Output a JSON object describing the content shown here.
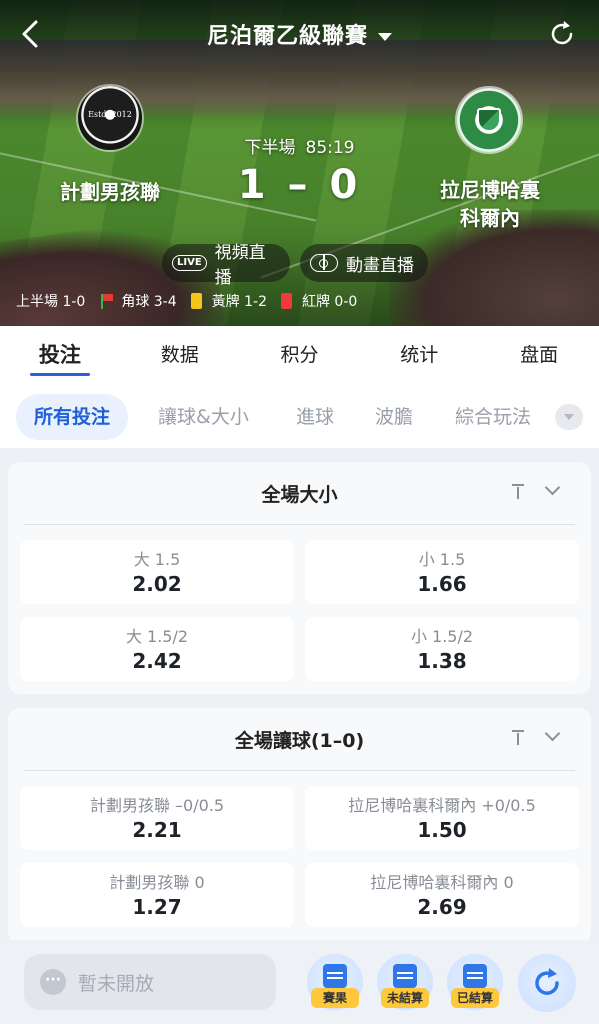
{
  "header": {
    "league_title": "尼泊爾乙級聯賽"
  },
  "match": {
    "home_team": "計劃男孩聯",
    "away_team_line1": "拉尼博哈裏",
    "away_team_line2": "科爾內",
    "home_logo_text": "Estd. 2012",
    "period": "下半場",
    "clock": "85:19",
    "score_home": "1",
    "score_sep": "–",
    "score_away": "0",
    "video_live_label": "視頻直播",
    "video_live_badge": "LIVE",
    "animation_live_label": "動畫直播",
    "stats": {
      "first_half": "上半場 1-0",
      "corners": "角球 3-4",
      "yellow_cards": "黃牌 1-2",
      "red_cards": "紅牌 0-0"
    }
  },
  "main_tabs": [
    "投注",
    "数据",
    "积分",
    "统计",
    "盘面"
  ],
  "sub_tabs": [
    "所有投注",
    "讓球&大小",
    "進球",
    "波膽",
    "綜合玩法"
  ],
  "markets": [
    {
      "title": "全場大小",
      "odds": [
        {
          "label": "大 1.5",
          "value": "2.02"
        },
        {
          "label": "小 1.5",
          "value": "1.66"
        },
        {
          "label": "大 1.5/2",
          "value": "2.42"
        },
        {
          "label": "小 1.5/2",
          "value": "1.38"
        }
      ]
    },
    {
      "title": "全場讓球(1–0)",
      "odds": [
        {
          "label": "計劃男孩聯 –0/0.5",
          "value": "2.21"
        },
        {
          "label": "拉尼博哈裏科爾內 +0/0.5",
          "value": "1.50"
        },
        {
          "label": "計劃男孩聯 0",
          "value": "1.27"
        },
        {
          "label": "拉尼博哈裏科爾內 0",
          "value": "2.69"
        }
      ]
    }
  ],
  "bottom": {
    "chat_placeholder": "暫未開放",
    "results_label": "賽果",
    "unsettled_label": "未結算",
    "settled_label": "已結算"
  },
  "colors": {
    "accent": "#2b5fe0",
    "sub_tab_active_bg": "#e8f1fd",
    "badge_yellow": "#ffc83a",
    "yellow_card": "#f5c518",
    "red_card": "#ef3b3b"
  }
}
